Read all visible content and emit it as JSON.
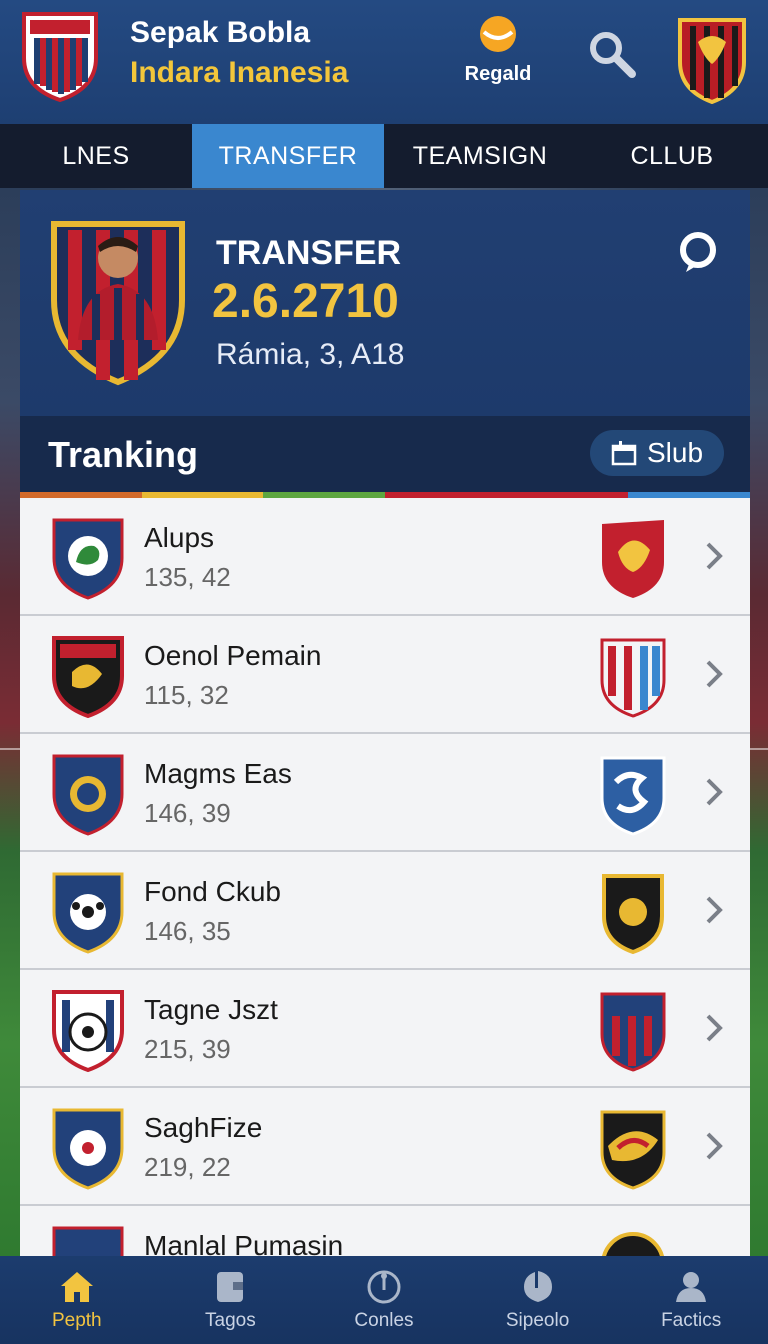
{
  "header": {
    "title": "Sepak Bobla",
    "subtitle": "Indara Inanesia",
    "reward_label": "Regald"
  },
  "tabs": [
    {
      "label": "LNES",
      "active": false
    },
    {
      "label": "TRANSFER",
      "active": true
    },
    {
      "label": "TEAMSIGN",
      "active": false
    },
    {
      "label": "CLLUB",
      "active": false
    }
  ],
  "transfer": {
    "title": "TRANSFER",
    "value": "2.6.2710",
    "date": "Rámia, 3, A18"
  },
  "tranking": {
    "title": "Tranking",
    "button_label": "Slub"
  },
  "rows": [
    {
      "name": "Alups",
      "score": "135, 42"
    },
    {
      "name": "Oenol Pemain",
      "score": "115, 32"
    },
    {
      "name": "Magms Eas",
      "score": "146, 39"
    },
    {
      "name": "Fond Ckub",
      "score": "146, 35"
    },
    {
      "name": "Tagne Jszt",
      "score": "215, 39"
    },
    {
      "name": "SaghFize",
      "score": "219, 22"
    },
    {
      "name": "Manlal Pumasin",
      "score": ""
    }
  ],
  "bottom_nav": [
    {
      "label": "Pepth",
      "icon": "home-icon",
      "active": true
    },
    {
      "label": "Tagos",
      "icon": "wallet-icon",
      "active": false
    },
    {
      "label": "Conles",
      "icon": "compass-icon",
      "active": false
    },
    {
      "label": "Sipeolo",
      "icon": "pin-icon",
      "active": false
    },
    {
      "label": "Factics",
      "icon": "user-icon",
      "active": false
    }
  ],
  "colors": {
    "accent_blue": "#3a87cf",
    "gold": "#f2c440",
    "header_bg": "#244a82"
  }
}
